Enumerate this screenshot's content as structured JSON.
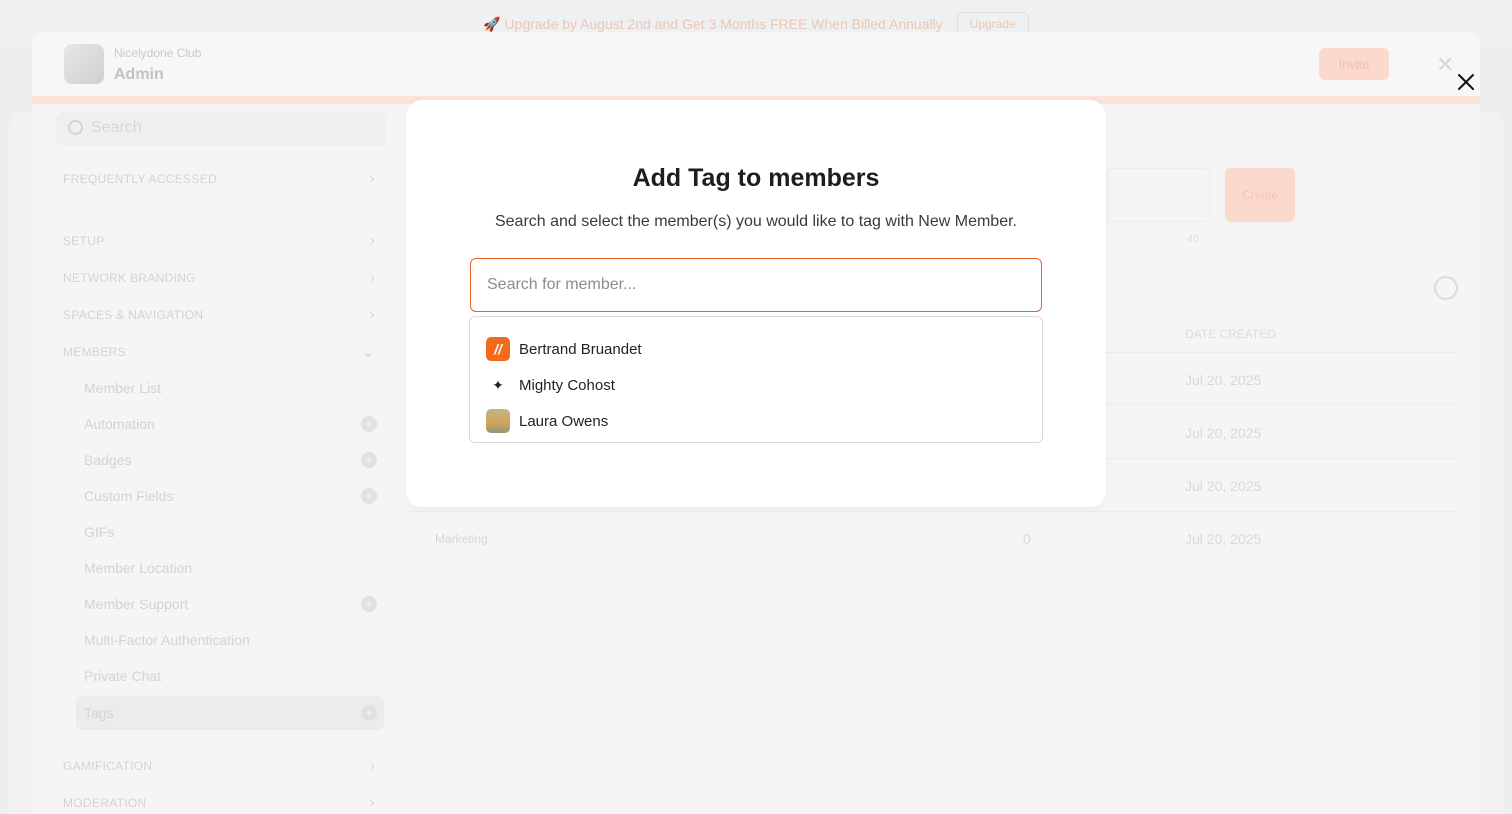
{
  "banner": {
    "text": "🚀 Upgrade by August 2nd and Get 3 Months FREE When Billed Annually",
    "button": "Upgrade"
  },
  "admin": {
    "club_name": "Nicelydone Club",
    "title": "Admin",
    "invite_label": "Invite"
  },
  "sidebar": {
    "search_placeholder": "Search",
    "sections": {
      "frequently": "FREQUENTLY ACCESSED",
      "setup": "SETUP",
      "branding": "NETWORK BRANDING",
      "spaces": "SPACES & NAVIGATION",
      "members": "MEMBERS",
      "gamification": "GAMIFICATION",
      "moderation": "MODERATION"
    },
    "member_items": [
      {
        "label": "Member List"
      },
      {
        "label": "Automation"
      },
      {
        "label": "Badges"
      },
      {
        "label": "Custom Fields"
      },
      {
        "label": "GIFs"
      },
      {
        "label": "Member Location"
      },
      {
        "label": "Member Support"
      },
      {
        "label": "Multi-Factor Authentication"
      },
      {
        "label": "Private Chat"
      },
      {
        "label": "Tags"
      }
    ]
  },
  "main": {
    "create_label": "Create",
    "counter": "40",
    "col_date": "DATE CREATED",
    "rows": [
      {
        "name": "",
        "count": "",
        "date": "Jul 20, 2025"
      },
      {
        "name": "",
        "count": "",
        "date": "Jul 20, 2025"
      },
      {
        "name": "",
        "count": "",
        "date": "Jul 20, 2025"
      },
      {
        "name": "Marketing",
        "count": "0",
        "date": "Jul 20, 2025"
      }
    ]
  },
  "modal": {
    "title": "Add Tag to members",
    "subtitle": "Search and select the member(s) you would like to tag with New Member.",
    "search_placeholder": "Search for member...",
    "options": [
      {
        "name": "Bertrand Bruandet",
        "avatar": "mighty-logo"
      },
      {
        "name": "Mighty Cohost",
        "avatar": "sparkle-icon"
      },
      {
        "name": "Laura Owens",
        "avatar": "photo"
      }
    ]
  },
  "colors": {
    "accent": "#e8622c",
    "brand_orange": "#f26b1d"
  }
}
